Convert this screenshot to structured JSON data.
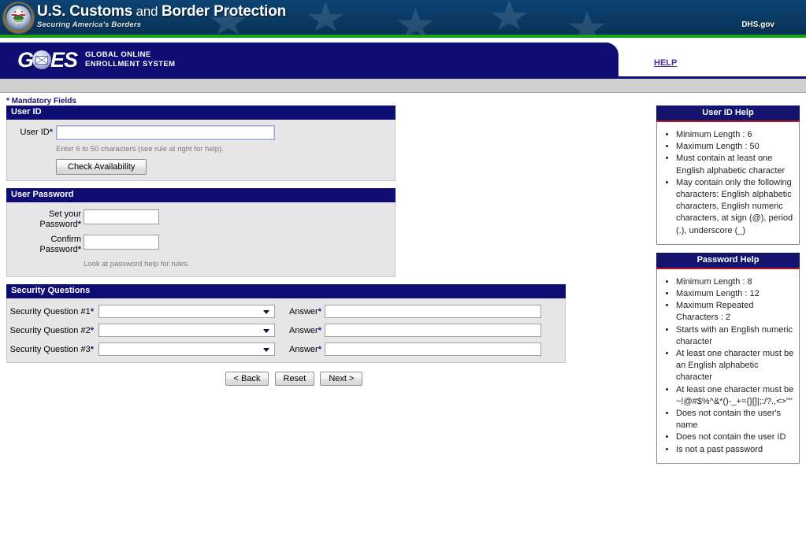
{
  "banner": {
    "agency_title_part1": "U.S. Customs",
    "agency_title_and": " and ",
    "agency_title_part2": "Border Protection",
    "tagline": "Securing America's Borders",
    "dhs_link": "DHS.gov",
    "seal_icon": "cbp-seal-icon"
  },
  "nav": {
    "logo_g": "G",
    "logo_es": "ES",
    "logo_globe_icon": "globe-envelope-icon",
    "subtitle_line1": "GLOBAL ONLINE",
    "subtitle_line2": "ENROLLMENT SYSTEM",
    "help_link": "HELP"
  },
  "page": {
    "mandatory_note": "* Mandatory Fields"
  },
  "user_id_section": {
    "heading": "User ID",
    "label": "User ID",
    "required_mark": "*",
    "value": "",
    "hint": "Enter 6 to 50 characters (see rule at right for help).",
    "check_button": "Check Availability"
  },
  "password_section": {
    "heading": "User Password",
    "set_label_line1": "Set your",
    "set_label_line2": "Password",
    "confirm_label_line1": "Confirm",
    "confirm_label_line2": "Password",
    "required_mark": "*",
    "set_value": "",
    "confirm_value": "",
    "hint": "Look at password help for rules."
  },
  "security_section": {
    "heading": "Security Questions",
    "required_mark": "*",
    "answer_label": "Answer",
    "rows": [
      {
        "label": "Security Question #1",
        "selected": "",
        "answer": ""
      },
      {
        "label": "Security Question #2",
        "selected": "",
        "answer": ""
      },
      {
        "label": "Security Question #3",
        "selected": "",
        "answer": ""
      }
    ]
  },
  "buttons": {
    "back": "< Back",
    "reset": "Reset",
    "next": "Next >"
  },
  "help": {
    "user_id": {
      "title": "User ID Help",
      "items": [
        "Minimum Length : 6",
        "Maximum Length : 50",
        "Must contain at least one English alphabetic character",
        "May contain only the following characters: English alphabetic characters, English numeric characters, at sign (@), period (.), underscore (_)"
      ]
    },
    "password": {
      "title": "Password Help",
      "items": [
        "Minimum Length : 8",
        "Maximum Length : 12",
        "Maximum Repeated Characters : 2",
        "Starts with an English numeric character",
        "At least one character must be an English alphabetic character",
        "At least one character must be ~!@#$%^&*()-_+={}[]|;:/?.,<>\"\"",
        "Does not contain the user's name",
        "Does not contain the user ID",
        "Is not a past password"
      ]
    }
  },
  "colors": {
    "banner_blue": "#0a3c68",
    "green_rule": "#16a316",
    "nav_navy": "#0d0d73",
    "help_header_navy": "#14146e",
    "help_header_underline_red": "#b11a22",
    "form_body_gray": "#e6e6e6",
    "link_purple": "#4b2a9e"
  }
}
